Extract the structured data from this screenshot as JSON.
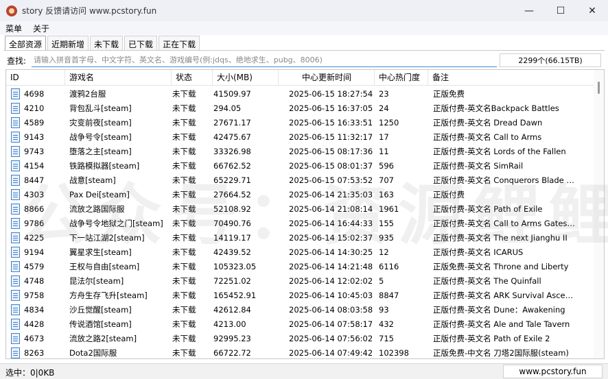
{
  "window": {
    "title": "story 反馈请访问 www.pcstory.fun",
    "minimize": "—",
    "maximize": "☐",
    "close": "✕"
  },
  "menu": [
    "菜单",
    "关于"
  ],
  "tabs": [
    "全部资源",
    "近期新增",
    "未下载",
    "已下载",
    "正在下载"
  ],
  "search": {
    "label": "查找:",
    "placeholder": "请输入拼音首字母、中文字符、英文名、游戏编号(例:jdqs、绝地求生、pubg、8006)",
    "value": ""
  },
  "total": "2299个(66.15TB)",
  "columns": [
    "ID",
    "游戏名",
    "状态",
    "大小(MB)",
    "中心更新时间",
    "中心热门度",
    "备注"
  ],
  "rows": [
    [
      "4698",
      "渡鸦2台服",
      "未下载",
      "41509.97",
      "2025-06-15 18:27:54",
      "23",
      "正版免费"
    ],
    [
      "4210",
      "背包乱斗[steam]",
      "未下载",
      "294.05",
      "2025-06-15 16:37:05",
      "24",
      "正版付费-英文名Backpack Battles"
    ],
    [
      "4589",
      "灾变前夜[steam]",
      "未下载",
      "27671.17",
      "2025-06-15 16:33:51",
      "1250",
      "正版付费-英文名 Dread Dawn"
    ],
    [
      "9143",
      "战争号令[steam]",
      "未下载",
      "42475.67",
      "2025-06-15 11:32:17",
      "17",
      "正版付费-英文名 Call to Arms"
    ],
    [
      "9743",
      "堕落之主[steam]",
      "未下载",
      "33326.98",
      "2025-06-15 08:17:36",
      "11",
      "正版付费-英文名 Lords of the Fallen"
    ],
    [
      "4154",
      "铁路模拟器[steam]",
      "未下载",
      "66762.52",
      "2025-06-15 08:01:37",
      "596",
      "正版付费-英文名 SimRail"
    ],
    [
      "8447",
      "战意[steam]",
      "未下载",
      "65229.71",
      "2025-06-15 07:53:52",
      "707",
      "正版付费-英文名 Conquerors Blade Fro..."
    ],
    [
      "4303",
      "Pax Dei[steam]",
      "未下载",
      "27664.52",
      "2025-06-14 21:35:03",
      "163",
      "正版付费"
    ],
    [
      "8866",
      "流放之路国际服",
      "未下载",
      "52108.92",
      "2025-06-14 21:08:14",
      "1961",
      "正版付费-英文名 Path of Exile"
    ],
    [
      "9786",
      "战争号令地狱之门[steam]",
      "未下载",
      "70490.76",
      "2025-06-14 16:44:33",
      "155",
      "正版付费-英文名 Call to Arms Gates of ..."
    ],
    [
      "4225",
      "下一站江湖2[steam]",
      "未下载",
      "14119.17",
      "2025-06-14 15:02:37",
      "935",
      "正版付费-英文名 The next Jianghu II"
    ],
    [
      "9194",
      "翼星求生[steam]",
      "未下载",
      "42439.52",
      "2025-06-14 14:30:25",
      "12",
      "正版付费-英文名 ICARUS"
    ],
    [
      "4579",
      "王权与自由[steam]",
      "未下载",
      "105323.05",
      "2025-06-14 14:21:48",
      "6116",
      "正版免费-英文名 Throne and Liberty"
    ],
    [
      "4748",
      "昆法尔[steam]",
      "未下载",
      "72251.02",
      "2025-06-14 12:02:02",
      "5",
      "正版付费-英文名 The Quinfall"
    ],
    [
      "9758",
      "方舟生存飞升[steam]",
      "未下载",
      "165452.91",
      "2025-06-14 10:45:03",
      "8847",
      "正版付费-英文名 ARK Survival Ascended"
    ],
    [
      "4834",
      "沙丘觉醒[steam]",
      "未下载",
      "42612.84",
      "2025-06-14 08:03:58",
      "93",
      "正版付费-英文名 Dune：Awakening"
    ],
    [
      "4428",
      "传说酒馆[steam]",
      "未下载",
      "4213.00",
      "2025-06-14 07:58:17",
      "432",
      "正版付费-英文名 Ale and Tale Tavern"
    ],
    [
      "4673",
      "流放之路2[steam]",
      "未下载",
      "92995.23",
      "2025-06-14 07:56:02",
      "715",
      "正版付费-英文名 Path of Exile 2"
    ],
    [
      "8263",
      "Dota2国际服",
      "未下载",
      "66722.72",
      "2025-06-14 07:49:42",
      "102398",
      "正版免费-中文名 刀塔2国际服(steam)"
    ]
  ],
  "status": {
    "selected": "选中：0|0KB",
    "site": "www.pcstory.fun"
  },
  "watermark": "公众号：资源鲤鲤",
  "colors": {
    "search_underline": "#3c8ddb",
    "file_icon": "#3e7cc6",
    "app_icon": "#b8432f"
  },
  "icons": {
    "app": "app-logo-icon",
    "row": "file-icon"
  }
}
